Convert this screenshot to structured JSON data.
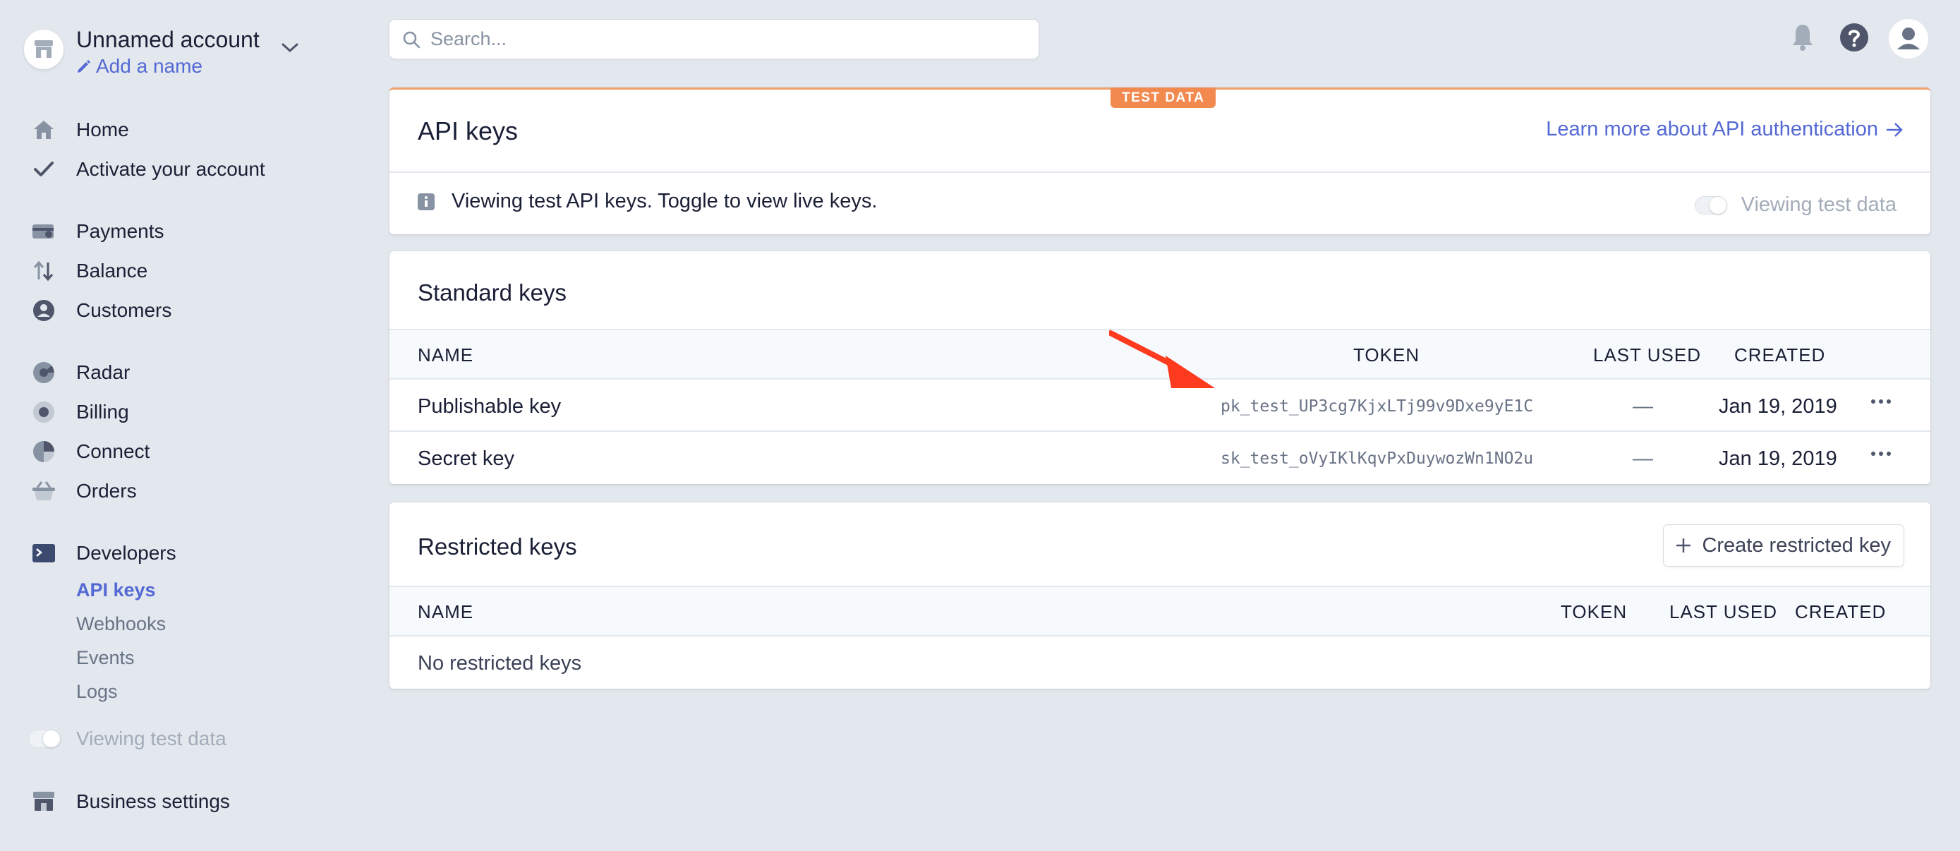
{
  "account": {
    "name": "Unnamed account",
    "add_name": "Add a name"
  },
  "search": {
    "placeholder": "Search..."
  },
  "nav": {
    "home": "Home",
    "activate": "Activate your account",
    "payments": "Payments",
    "balance": "Balance",
    "customers": "Customers",
    "radar": "Radar",
    "billing": "Billing",
    "connect": "Connect",
    "orders": "Orders",
    "developers": "Developers",
    "api_keys": "API keys",
    "webhooks": "Webhooks",
    "events": "Events",
    "logs": "Logs",
    "viewing_test": "Viewing test data",
    "business_settings": "Business settings"
  },
  "header": {
    "badge": "TEST DATA",
    "title": "API keys",
    "learn_more": "Learn more about API authentication",
    "info": "Viewing test API keys. Toggle to view live keys.",
    "toggle_label": "Viewing test data"
  },
  "standard": {
    "title": "Standard keys",
    "columns": {
      "name": "NAME",
      "token": "TOKEN",
      "last_used": "LAST USED",
      "created": "CREATED"
    },
    "rows": [
      {
        "name": "Publishable key",
        "token": "pk_test_UP3cg7KjxLTj99v9Dxe9yE1C",
        "last_used": "—",
        "created": "Jan 19, 2019"
      },
      {
        "name": "Secret key",
        "token": "sk_test_oVyIKlKqvPxDuywozWn1NO2u",
        "last_used": "—",
        "created": "Jan 19, 2019"
      }
    ]
  },
  "restricted": {
    "title": "Restricted keys",
    "create_button": "Create restricted key",
    "columns": {
      "name": "NAME",
      "token": "TOKEN",
      "last_used": "LAST USED",
      "created": "CREATED"
    },
    "empty": "No restricted keys"
  },
  "colors": {
    "accent": "#5469d4",
    "badge": "#f28a50",
    "arrow": "#ff3b1f",
    "background": "#e3e8ee"
  }
}
